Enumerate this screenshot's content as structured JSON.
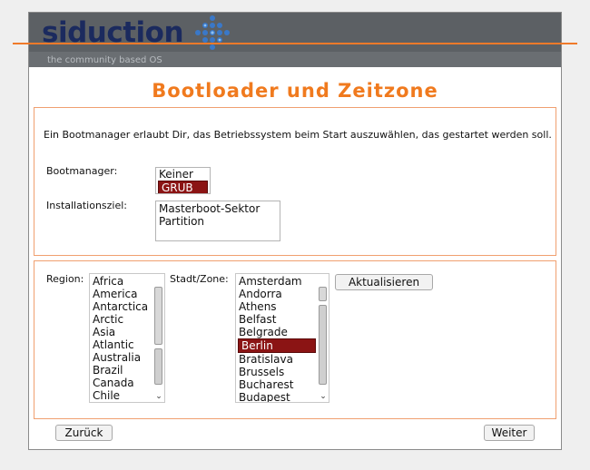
{
  "header": {
    "logo_text": "siduction",
    "tagline": "the community based OS",
    "brand_color": "#f07a1e"
  },
  "page": {
    "title": "Bootloader und Zeitzone"
  },
  "bootloader": {
    "description": "Ein Bootmanager erlaubt Dir, das Betriebssystem beim Start auszuwählen, das gestartet werden soll.",
    "bootmanager_label": "Bootmanager:",
    "bootmanager_options": [
      "Keiner",
      "GRUB"
    ],
    "bootmanager_selected": "GRUB",
    "target_label": "Installationsziel:",
    "target_options": [
      "Masterboot-Sektor",
      "Partition"
    ]
  },
  "timezone": {
    "region_label": "Region:",
    "regions": [
      "Africa",
      "America",
      "Antarctica",
      "Arctic",
      "Asia",
      "Atlantic",
      "Australia",
      "Brazil",
      "Canada",
      "Chile"
    ],
    "city_label": "Stadt/Zone:",
    "cities": [
      "Amsterdam",
      "Andorra",
      "Athens",
      "Belfast",
      "Belgrade",
      "Berlin",
      "Bratislava",
      "Brussels",
      "Bucharest",
      "Budapest"
    ],
    "city_selected": "Berlin",
    "refresh_label": "Aktualisieren"
  },
  "footer": {
    "back_label": "Zurück",
    "next_label": "Weiter"
  }
}
